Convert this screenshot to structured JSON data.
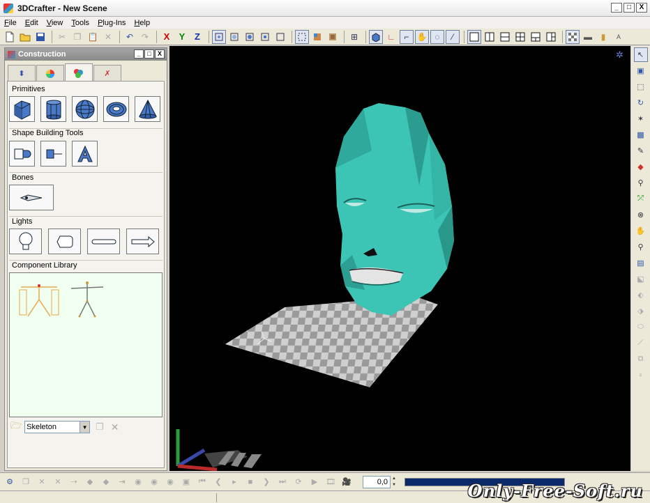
{
  "window": {
    "title": "3DCrafter - New Scene",
    "controls": [
      "_",
      "□",
      "X"
    ]
  },
  "menu": [
    {
      "label": "File",
      "key": "F",
      "rest": "ile"
    },
    {
      "label": "Edit",
      "key": "E",
      "rest": "dit"
    },
    {
      "label": "View",
      "key": "V",
      "rest": "iew"
    },
    {
      "label": "Tools",
      "key": "T",
      "rest": "ools"
    },
    {
      "label": "Plug-Ins",
      "key": "P",
      "rest": "lug-Ins"
    },
    {
      "label": "Help",
      "key": "H",
      "rest": "elp"
    }
  ],
  "toolbar": {
    "axis_x": "X",
    "axis_y": "Y",
    "axis_z": "Z"
  },
  "panel": {
    "title": "Construction",
    "controls": [
      "_",
      "□",
      "X"
    ],
    "sections": {
      "primitives": "Primitives",
      "shape_tools": "Shape Building Tools",
      "bones": "Bones",
      "lights": "Lights",
      "component_library": "Component Library"
    },
    "library_select": "Skeleton"
  },
  "timeline": {
    "frame_value": "0,0"
  },
  "watermark": "Only-Free-Soft.ru",
  "colors": {
    "viewport_bg": "#000000",
    "head": "#3cc4b4",
    "progress": "#0a2a6a"
  }
}
